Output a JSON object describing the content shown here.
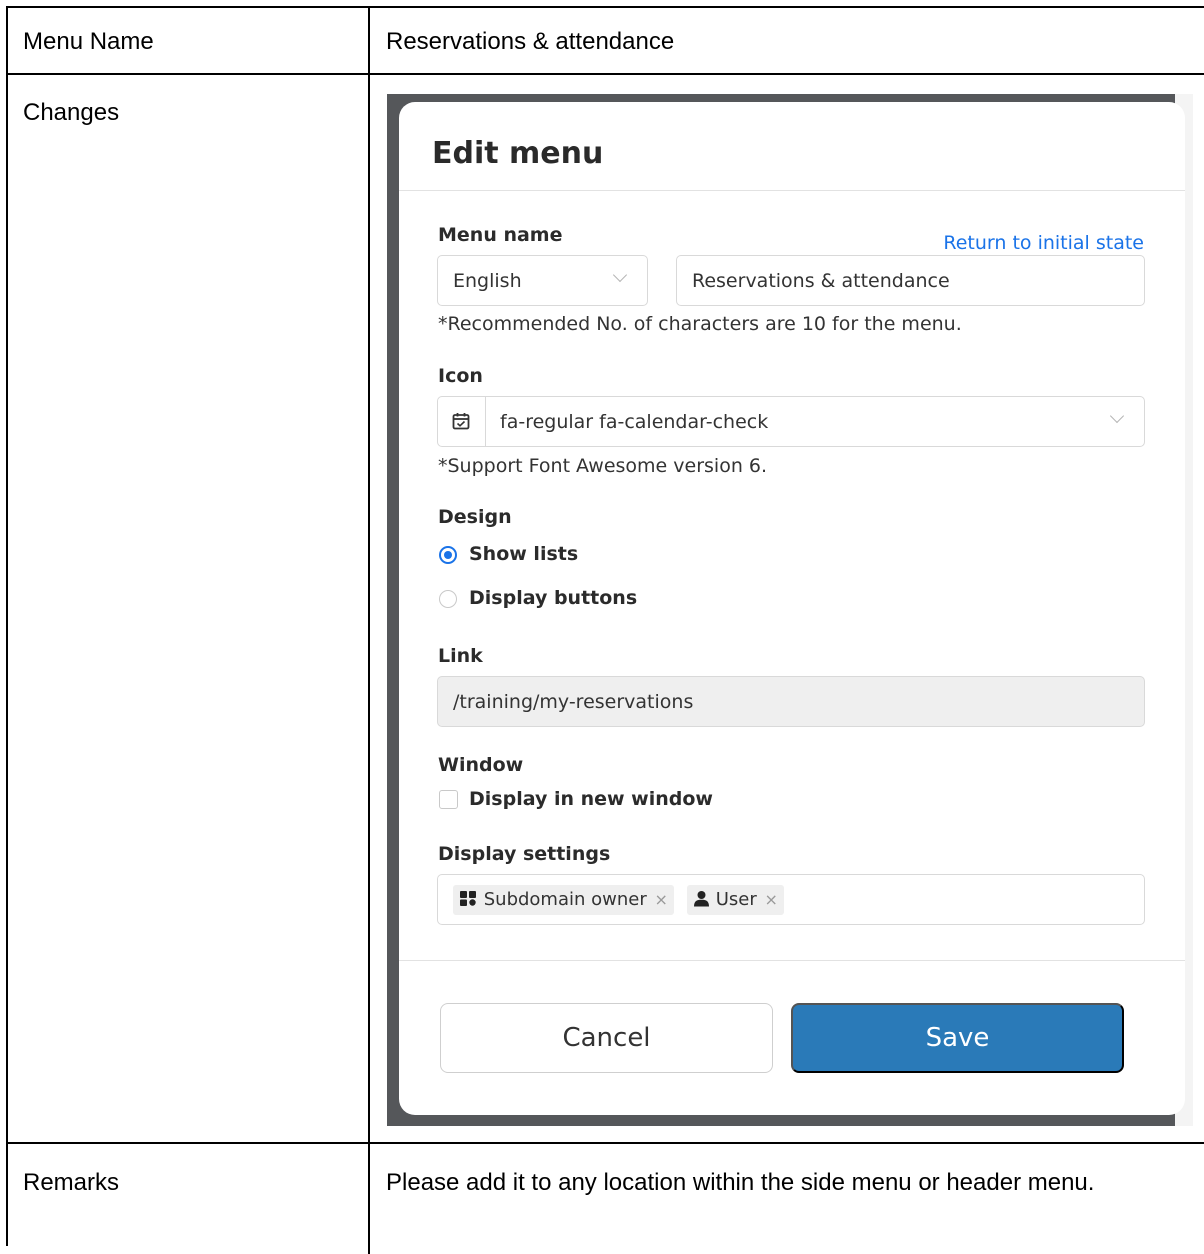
{
  "table": {
    "rows": [
      {
        "label": "Menu Name",
        "value": "Reservations & attendance"
      },
      {
        "label": "Changes"
      },
      {
        "label": "Remarks",
        "value": "Please add it to any location within the side menu or header menu."
      }
    ]
  },
  "modal": {
    "title": "Edit menu",
    "menu_name": {
      "label": "Menu name",
      "reset_link": "Return to initial state",
      "language": "English",
      "value": "Reservations & attendance",
      "hint": "*Recommended No. of characters are 10 for the menu."
    },
    "icon": {
      "label": "Icon",
      "value": "fa-regular fa-calendar-check",
      "icon_name": "calendar-check-icon",
      "hint": "*Support Font Awesome version 6."
    },
    "design": {
      "label": "Design",
      "options": [
        {
          "label": "Show lists",
          "selected": true
        },
        {
          "label": "Display buttons",
          "selected": false
        }
      ]
    },
    "link": {
      "label": "Link",
      "value": "/training/my-reservations"
    },
    "window": {
      "label": "Window",
      "checkbox_label": "Display in new window",
      "checked": false
    },
    "display_settings": {
      "label": "Display settings",
      "tags": [
        {
          "label": "Subdomain owner",
          "icon": "user-group-icon",
          "remove": "×"
        },
        {
          "label": "User",
          "icon": "user-icon",
          "remove": "×"
        }
      ]
    },
    "buttons": {
      "cancel": "Cancel",
      "save": "Save"
    },
    "colors": {
      "accent": "#1a73e8",
      "save_button": "#2a7ab8"
    }
  }
}
